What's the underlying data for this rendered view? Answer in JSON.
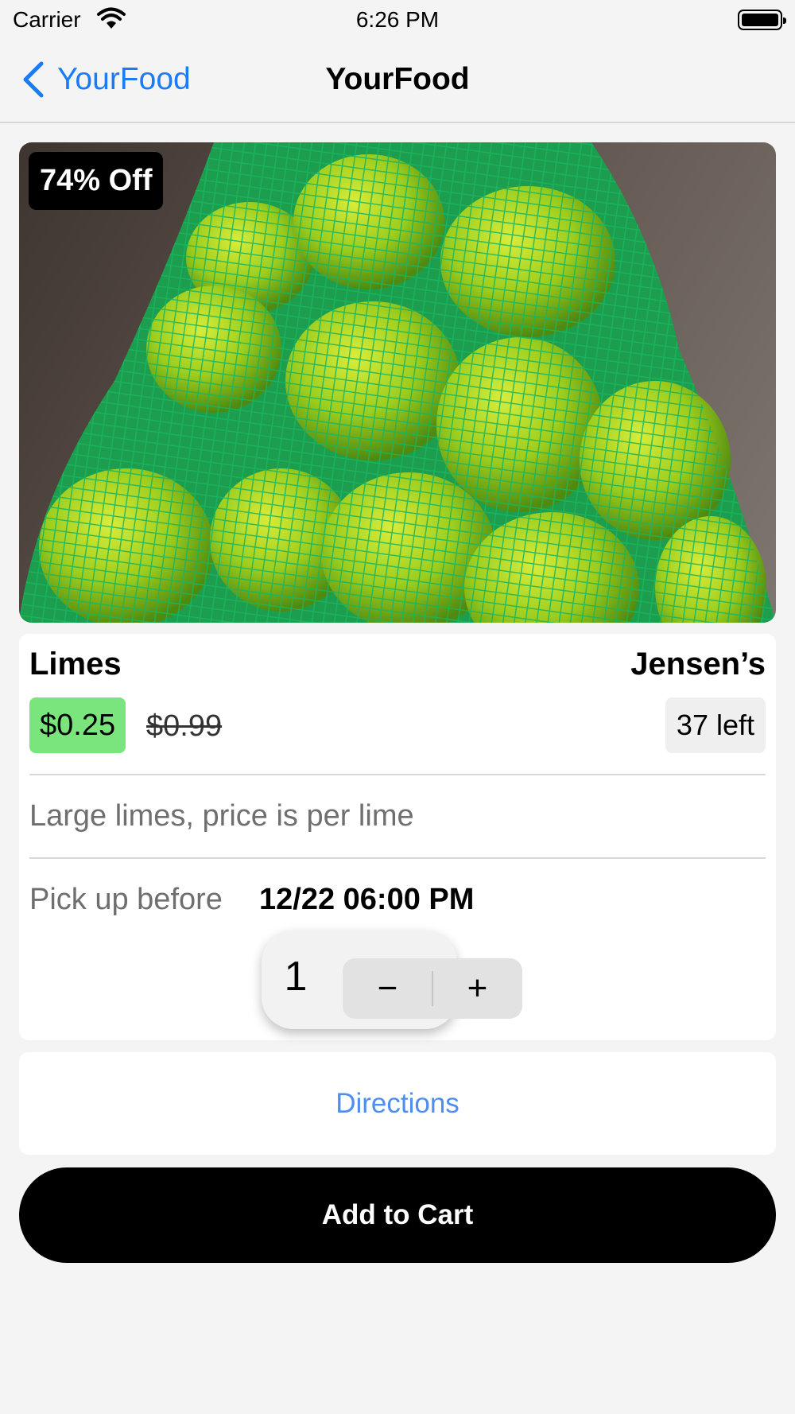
{
  "status_bar": {
    "carrier": "Carrier",
    "time": "6:26 PM",
    "icons": [
      "wifi-icon",
      "battery-icon"
    ]
  },
  "nav": {
    "back_label": "YourFood",
    "title": "YourFood",
    "icons": [
      "chevron-left-icon"
    ]
  },
  "product": {
    "image": "photo of green limes in mesh bag",
    "discount_badge": "74% Off",
    "name": "Limes",
    "store": "Jensen’s",
    "price": "$0.25",
    "original_price": "$0.99",
    "stock": "37 left",
    "description": "Large limes, price is per lime",
    "pickup_label": "Pick up before",
    "pickup_time": "12/22 06:00 PM"
  },
  "quantity": {
    "value": "1",
    "minus": "−",
    "plus": "+"
  },
  "actions": {
    "directions": "Directions",
    "add_to_cart": "Add to Cart"
  },
  "colors": {
    "accent": "#1a7cf5",
    "link": "#4f8ef0",
    "price_badge": "#7be57d",
    "button": "#000000",
    "background": "#f4f4f4"
  }
}
